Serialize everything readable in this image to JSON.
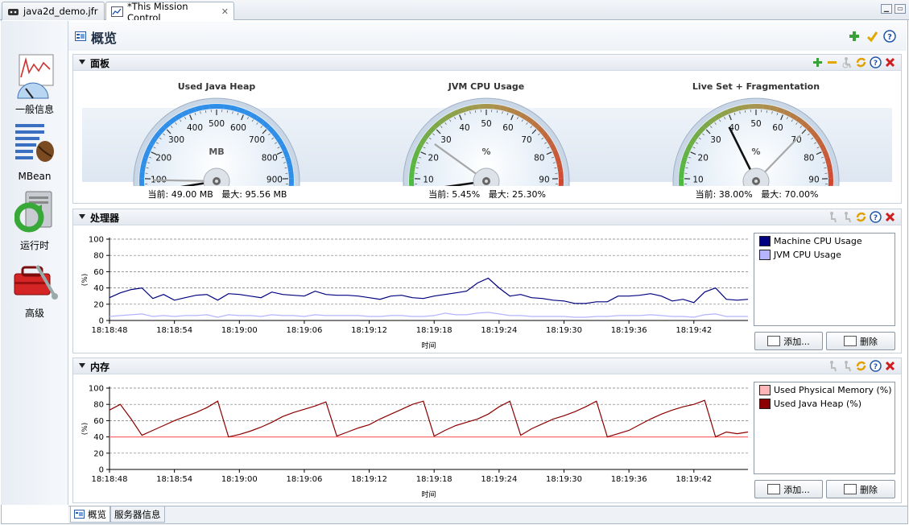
{
  "tabs": [
    {
      "label": "java2d_demo.jfr",
      "active": false
    },
    {
      "label": "*This Mission Control",
      "active": true
    }
  ],
  "nav": [
    {
      "label": "一般信息",
      "icon": "general-info-icon"
    },
    {
      "label": "MBean",
      "icon": "mbean-icon"
    },
    {
      "label": "运行时",
      "icon": "runtime-icon"
    },
    {
      "label": "高级",
      "icon": "advanced-toolbox-icon"
    }
  ],
  "page": {
    "title": "概览"
  },
  "dashboard": {
    "title": "面板",
    "gauges": [
      {
        "title": "Used Java Heap",
        "unit": "MB",
        "ticks": [
          "0",
          "100",
          "200",
          "300",
          "400",
          "500",
          "600",
          "700",
          "800",
          "900",
          "1000"
        ],
        "min": 0,
        "max": 1000,
        "current": 49,
        "maxval": 95.56,
        "current_label": "当前: 49.00 MB",
        "max_label": "最大: 95.56 MB",
        "bands": [
          "#2f8fe8",
          "#2f8fe8"
        ]
      },
      {
        "title": "JVM CPU Usage",
        "unit": "%",
        "ticks": [
          "0",
          "10",
          "20",
          "30",
          "40",
          "50",
          "60",
          "70",
          "80",
          "90",
          "100"
        ],
        "min": 0,
        "max": 100,
        "current": 5.45,
        "maxval": 25.3,
        "current_label": "当前: 5.45%",
        "max_label": "最大: 25.30%",
        "bands": [
          "#3cc23c",
          "#d93a2a"
        ]
      },
      {
        "title": "Live Set + Fragmentation",
        "unit": "%",
        "ticks": [
          "0",
          "10",
          "20",
          "30",
          "40",
          "50",
          "60",
          "70",
          "80",
          "90",
          "100"
        ],
        "min": 0,
        "max": 100,
        "current": 38,
        "maxval": 70,
        "current_label": "当前: 38.00%",
        "max_label": "最大: 70.00%",
        "bands": [
          "#3cc23c",
          "#d93a2a"
        ]
      }
    ]
  },
  "processor": {
    "title": "处理器"
  },
  "memory": {
    "title": "内存"
  },
  "buttons": {
    "add": "添加...",
    "remove": "删除"
  },
  "bottom_tabs": [
    "概览",
    "服务器信息"
  ],
  "colors": {
    "machine_cpu": "#000080",
    "jvm_cpu": "#b4b4ff",
    "physical_mem": "#ffb6b6",
    "java_heap": "#8b0000",
    "accent": "#2f8fe8"
  },
  "chart_data": [
    {
      "type": "line",
      "title": "处理器",
      "xlabel": "时间",
      "ylabel": "(%)",
      "ylim": [
        0,
        100
      ],
      "yticks": [
        "0",
        "20",
        "40",
        "60",
        "80",
        "100"
      ],
      "xticks": [
        "18:18:48",
        "18:18:54",
        "18:19:00",
        "18:19:06",
        "18:19:12",
        "18:19:18",
        "18:19:24",
        "18:19:30",
        "18:19:36",
        "18:19:42"
      ],
      "x": [
        "18:18:48",
        "18:18:49",
        "18:18:50",
        "18:18:51",
        "18:18:52",
        "18:18:53",
        "18:18:54",
        "18:18:55",
        "18:18:56",
        "18:18:57",
        "18:18:58",
        "18:18:59",
        "18:19:00",
        "18:19:01",
        "18:19:02",
        "18:19:03",
        "18:19:04",
        "18:19:05",
        "18:19:06",
        "18:19:07",
        "18:19:08",
        "18:19:09",
        "18:19:10",
        "18:19:11",
        "18:19:12",
        "18:19:13",
        "18:19:14",
        "18:19:15",
        "18:19:16",
        "18:19:17",
        "18:19:18",
        "18:19:19",
        "18:19:20",
        "18:19:21",
        "18:19:22",
        "18:19:23",
        "18:19:24",
        "18:19:25",
        "18:19:26",
        "18:19:27",
        "18:19:28",
        "18:19:29",
        "18:19:30",
        "18:19:31",
        "18:19:32",
        "18:19:33",
        "18:19:34",
        "18:19:35",
        "18:19:36",
        "18:19:37",
        "18:19:38",
        "18:19:39",
        "18:19:40",
        "18:19:41",
        "18:19:42",
        "18:19:43",
        "18:19:44",
        "18:19:45",
        "18:19:46",
        "18:19:47"
      ],
      "series": [
        {
          "name": "Machine CPU Usage",
          "color": "#000080",
          "values": [
            28,
            34,
            38,
            40,
            27,
            32,
            25,
            28,
            31,
            32,
            25,
            33,
            32,
            30,
            28,
            35,
            32,
            31,
            30,
            36,
            32,
            31,
            31,
            30,
            28,
            26,
            30,
            31,
            28,
            27,
            30,
            32,
            34,
            36,
            46,
            52,
            40,
            30,
            32,
            28,
            27,
            25,
            24,
            21,
            21,
            23,
            23,
            30,
            30,
            31,
            33,
            30,
            24,
            26,
            22,
            35,
            40,
            26,
            25,
            26
          ]
        },
        {
          "name": "JVM CPU Usage",
          "color": "#b4b4ff",
          "values": [
            5,
            6,
            7,
            8,
            5,
            6,
            5,
            6,
            6,
            7,
            4,
            7,
            6,
            6,
            5,
            7,
            6,
            6,
            5,
            7,
            6,
            6,
            6,
            6,
            5,
            5,
            6,
            6,
            5,
            5,
            6,
            9,
            7,
            7,
            9,
            10,
            8,
            6,
            6,
            5,
            5,
            5,
            5,
            4,
            4,
            5,
            5,
            6,
            6,
            6,
            7,
            6,
            5,
            5,
            4,
            7,
            8,
            5,
            5,
            5
          ]
        }
      ],
      "legend": "right"
    },
    {
      "type": "line",
      "title": "内存",
      "xlabel": "时间",
      "ylabel": "(%)",
      "ylim": [
        0,
        100
      ],
      "yticks": [
        "0",
        "20",
        "40",
        "60",
        "80",
        "100"
      ],
      "xticks": [
        "18:18:48",
        "18:18:54",
        "18:19:00",
        "18:19:06",
        "18:19:12",
        "18:19:18",
        "18:19:24",
        "18:19:30",
        "18:19:36",
        "18:19:42"
      ],
      "x": [
        "18:18:48",
        "18:18:49",
        "18:18:50",
        "18:18:51",
        "18:18:52",
        "18:18:53",
        "18:18:54",
        "18:18:55",
        "18:18:56",
        "18:18:57",
        "18:18:58",
        "18:18:59",
        "18:19:00",
        "18:19:01",
        "18:19:02",
        "18:19:03",
        "18:19:04",
        "18:19:05",
        "18:19:06",
        "18:19:07",
        "18:19:08",
        "18:19:09",
        "18:19:10",
        "18:19:11",
        "18:19:12",
        "18:19:13",
        "18:19:14",
        "18:19:15",
        "18:19:16",
        "18:19:17",
        "18:19:18",
        "18:19:19",
        "18:19:20",
        "18:19:21",
        "18:19:22",
        "18:19:23",
        "18:19:24",
        "18:19:25",
        "18:19:26",
        "18:19:27",
        "18:19:28",
        "18:19:29",
        "18:19:30",
        "18:19:31",
        "18:19:32",
        "18:19:33",
        "18:19:34",
        "18:19:35",
        "18:19:36",
        "18:19:37",
        "18:19:38",
        "18:19:39",
        "18:19:40",
        "18:19:41",
        "18:19:42",
        "18:19:43",
        "18:19:44",
        "18:19:45",
        "18:19:46",
        "18:19:47"
      ],
      "series": [
        {
          "name": "Used Physical Memory (%)",
          "color": "#ff6b6b",
          "values": [
            40,
            40,
            40,
            40,
            40,
            40,
            40,
            40,
            40,
            40,
            40,
            40,
            40,
            40,
            40,
            40,
            40,
            40,
            40,
            40,
            40,
            40,
            40,
            40,
            40,
            40,
            40,
            40,
            40,
            40,
            40,
            40,
            40,
            40,
            40,
            40,
            40,
            40,
            40,
            40,
            40,
            40,
            40,
            40,
            40,
            40,
            40,
            40,
            40,
            40,
            40,
            40,
            40,
            40,
            40,
            40,
            40,
            40,
            40,
            40
          ]
        },
        {
          "name": "Used Java Heap (%)",
          "color": "#8b0000",
          "values": [
            73,
            80,
            62,
            42,
            48,
            54,
            60,
            65,
            70,
            76,
            84,
            40,
            43,
            47,
            52,
            58,
            65,
            70,
            74,
            78,
            83,
            41,
            46,
            51,
            55,
            62,
            68,
            74,
            80,
            84,
            41,
            48,
            54,
            58,
            62,
            68,
            77,
            84,
            42,
            50,
            56,
            62,
            66,
            71,
            77,
            84,
            40,
            44,
            48,
            55,
            62,
            68,
            73,
            77,
            80,
            85,
            40,
            46,
            44,
            46
          ]
        }
      ],
      "legend": "right"
    }
  ]
}
